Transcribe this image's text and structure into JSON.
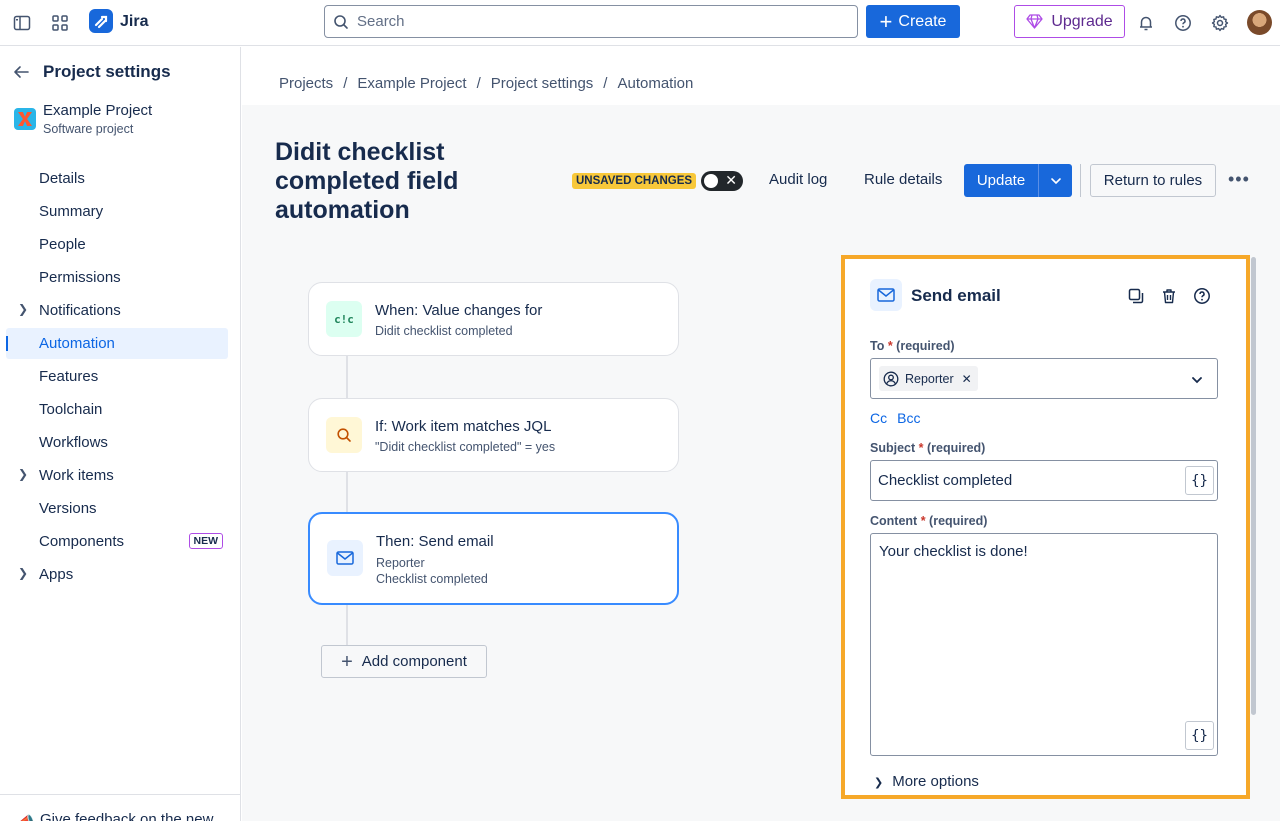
{
  "topnav": {
    "app_name": "Jira",
    "search_placeholder": "Search",
    "create_label": "Create",
    "upgrade_label": "Upgrade"
  },
  "sidebar": {
    "title": "Project settings",
    "project_name": "Example Project",
    "project_type": "Software project",
    "items": [
      {
        "label": "Details"
      },
      {
        "label": "Summary"
      },
      {
        "label": "People"
      },
      {
        "label": "Permissions"
      },
      {
        "label": "Notifications"
      },
      {
        "label": "Automation"
      },
      {
        "label": "Features"
      },
      {
        "label": "Toolchain"
      },
      {
        "label": "Workflows"
      },
      {
        "label": "Work items"
      },
      {
        "label": "Versions"
      },
      {
        "label": "Components"
      },
      {
        "label": "Apps"
      }
    ],
    "new_badge": "NEW",
    "footer_text": "Give feedback on the new navigation"
  },
  "breadcrumbs": [
    "Projects",
    "Example Project",
    "Project settings",
    "Automation"
  ],
  "rule": {
    "title": "Didit checklist completed field automation",
    "unsaved_badge": "UNSAVED CHANGES",
    "audit_log": "Audit log",
    "rule_details": "Rule details",
    "update_label": "Update",
    "return_label": "Return to rules"
  },
  "flow": {
    "trigger_title": "When: Value changes for",
    "trigger_sub": "Didit checklist completed",
    "condition_title": "If: Work item matches JQL",
    "condition_sub": "\"Didit checklist completed\" = yes",
    "action_title": "Then: Send email",
    "action_sub1": "Reporter",
    "action_sub2": "Checklist completed",
    "add_component": "Add component"
  },
  "panel": {
    "title": "Send email",
    "to_label": "To",
    "to_req": "(required)",
    "to_chip": "Reporter",
    "cc": "Cc",
    "bcc": "Bcc",
    "subject_label": "Subject",
    "subject_req": "(required)",
    "subject_value": "Checklist completed",
    "content_label": "Content",
    "content_req": "(required)",
    "content_value": "Your checklist is done!",
    "brace": "{}",
    "more_options": "More options"
  },
  "colors": {
    "brand": "#1868db",
    "highlight": "#f6a829",
    "unsaved": "#f8c83a"
  }
}
